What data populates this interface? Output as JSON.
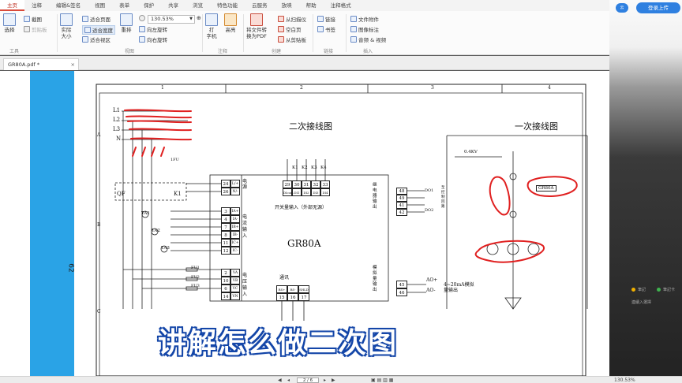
{
  "menu": {
    "tabs": [
      "主页",
      "注释",
      "编辑&签名",
      "视图",
      "表单",
      "保护",
      "共享",
      "浏览",
      "特色功能",
      "云服务",
      "放映",
      "帮助",
      "注释格式"
    ]
  },
  "ribbon": {
    "tools": {
      "select": "选择",
      "screenshot": "截图",
      "clipboard": "剪贴板",
      "group": "工具"
    },
    "view": {
      "actual_size": "实际\n大小",
      "fit_page": "适合页面",
      "fit_width": "适合宽度",
      "fit_visible": "适合视区",
      "reflow": "重排",
      "zoom": "130.53%",
      "rotate_left": "向左旋转",
      "rotate_right": "向右旋转",
      "group": "视图"
    },
    "comment": {
      "typewriter": "打\n字机",
      "highlight": "高亮",
      "group": "注释"
    },
    "create": {
      "convert": "将文件转\n换为PDF",
      "from_scanner": "从扫描仪",
      "blank": "空白页",
      "from_clipboard": "从剪贴板",
      "group": "创建"
    },
    "link": {
      "link": "链接",
      "bookmark": "书签",
      "group": "链接"
    },
    "insert": {
      "attachment": "文件附件",
      "image": "图像标注",
      "audio_video": "音频 & 视频",
      "group": "插入"
    }
  },
  "account": {
    "login": "登录上传",
    "cloud": "云"
  },
  "side": {
    "item1": "筆記",
    "item2": "筆記卡",
    "item3": "連續入選擇"
  },
  "document": {
    "tab_title": "GR80A.pdf *",
    "prev_page_number": "62",
    "title_secondary": "二次接线图",
    "title_primary": "一次接线图",
    "device": "GR80A",
    "lines": [
      "L1",
      "L2",
      "L3",
      "N"
    ],
    "qf": "QF",
    "k1": "K1",
    "fu": "1FU",
    "ta": [
      "TA1",
      "TA2",
      "TA3"
    ],
    "fu_v": [
      "FU1",
      "FU2",
      "FU3"
    ],
    "terminals_power": [
      {
        "num": "24",
        "name": "L/+"
      },
      {
        "num": "26",
        "name": "N/-"
      }
    ],
    "label_power": "电\n源",
    "terminals_current": [
      {
        "num": "3",
        "name": "IA+"
      },
      {
        "num": "4",
        "name": "IA-"
      },
      {
        "num": "7",
        "name": "IB+"
      },
      {
        "num": "8",
        "name": "IB-"
      },
      {
        "num": "11",
        "name": "IC+"
      },
      {
        "num": "12",
        "name": "IC-"
      }
    ],
    "label_current": "电\n流\n输\n入",
    "terminals_voltage": [
      {
        "num": "2",
        "name": "VA"
      },
      {
        "num": "10",
        "name": "VB"
      },
      {
        "num": "6",
        "name": "VC"
      },
      {
        "num": "14",
        "name": "VN"
      }
    ],
    "label_voltage": "电\n压\n输\n入",
    "switch_nums": [
      "29",
      "30",
      "31",
      "32",
      "33"
    ],
    "switch_names": [
      "DIcom",
      "DI1",
      "DI2",
      "DI3",
      "DI4"
    ],
    "switches": [
      "K1",
      "K2",
      "K3",
      "K4"
    ],
    "switch_label": "开关量输入（外部无源）",
    "relay_label": "继\n电\n器\n输\n出",
    "relay_terms": [
      "48",
      "49",
      "41",
      "42"
    ],
    "relay_outputs": [
      "DO1",
      "DO2"
    ],
    "relay_side": "至\n控\n制\n回\n路",
    "comm_label": "通讯",
    "comm_terms": [
      "RS+",
      "RS-",
      "SHLD"
    ],
    "comm_nums": [
      "15",
      "16",
      "17"
    ],
    "analog_label": "模\n拟\n量\n输\n出",
    "analog_terms": [
      "45",
      "46"
    ],
    "analog_out": [
      "AO+",
      "AO-"
    ],
    "analog_desc": "4~20mA模拟\n量输出",
    "voltage_level": "0.4KV",
    "device_box": "GR80A",
    "col_nums": [
      "1",
      "2",
      "3",
      "4"
    ],
    "row_letters": [
      "A",
      "B",
      "C"
    ]
  },
  "caption": "讲解怎么做二次图",
  "status": {
    "page": "2 / 6",
    "zoom": "130.53%"
  },
  "colors": {
    "accent": "#d94a3a",
    "annotation": "#e02020",
    "caption_stroke": "#1446a8",
    "page_strip": "#2aa3e6"
  }
}
